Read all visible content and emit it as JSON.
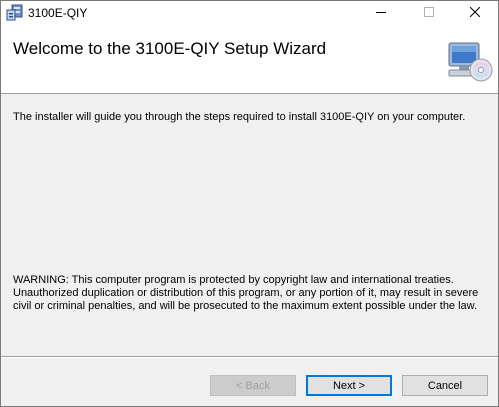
{
  "window": {
    "title": "3100E-QIY",
    "minimize_icon": "minimize-icon",
    "maximize_icon": "maximize-icon",
    "close_icon": "close-icon"
  },
  "header": {
    "title": "Welcome to the 3100E-QIY Setup Wizard",
    "icon": "computer-cd-icon"
  },
  "content": {
    "intro": "The installer will guide you through the steps required to install 3100E-QIY on your computer.",
    "warning": "WARNING: This computer program is protected by copyright law and international treaties. Unauthorized duplication or distribution of this program, or any portion of it, may result in severe civil or criminal penalties, and will be prosecuted to the maximum extent possible under the law."
  },
  "buttons": {
    "back_label": "< Back",
    "next_label": "Next >",
    "cancel_label": "Cancel"
  },
  "colors": {
    "accent": "#0078d7",
    "dialog_bg": "#f0f0f0",
    "header_bg": "#ffffff"
  }
}
